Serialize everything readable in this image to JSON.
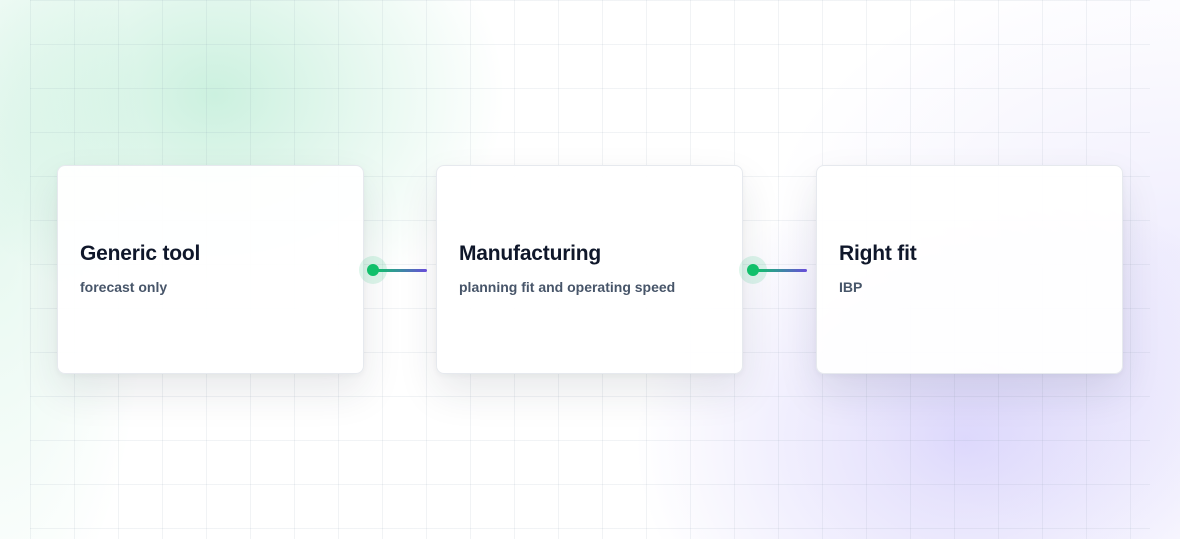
{
  "flow": {
    "steps": [
      {
        "title": "Generic tool",
        "subtitle": "forecast only"
      },
      {
        "title": "Manufacturing",
        "subtitle": "planning fit and operating speed"
      },
      {
        "title": "Right fit",
        "subtitle": "IBP"
      }
    ]
  },
  "colors": {
    "accent_green": "#10c06a",
    "accent_purple": "#6d4fe0",
    "title_text": "#0f172a",
    "subtitle_text": "#475569"
  }
}
